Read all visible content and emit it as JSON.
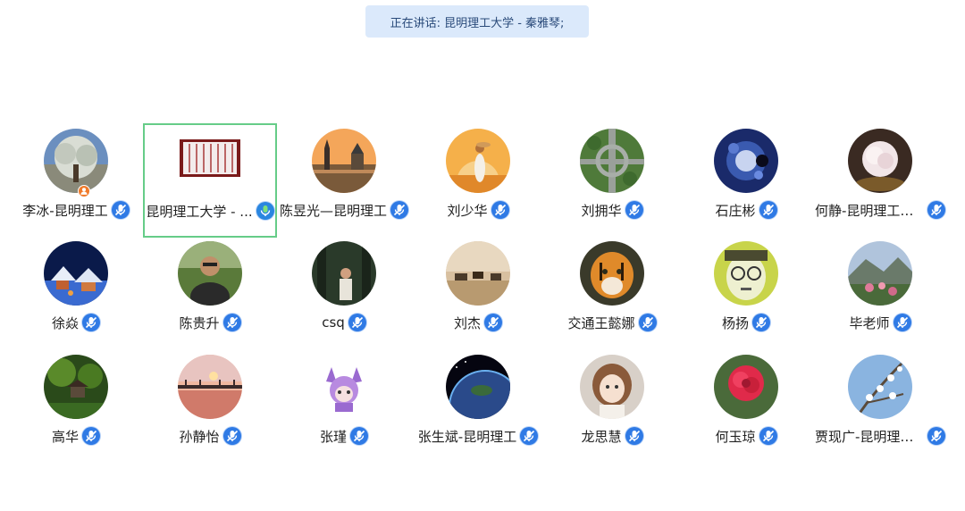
{
  "banner": {
    "text": "正在讲话: 昆明理工大学 - 秦雅琴;"
  },
  "participants": [
    {
      "name": "李冰-昆明理工",
      "host": true,
      "mic": "muted",
      "avatar": "tree"
    },
    {
      "name": "昆明理工大学 - ...",
      "host": false,
      "mic": "speaking",
      "avatar": "scroll",
      "active": true
    },
    {
      "name": "陈昱光—昆明理工",
      "host": false,
      "mic": "muted",
      "avatar": "castle"
    },
    {
      "name": "刘少华",
      "host": false,
      "mic": "muted",
      "avatar": "sunset-girl"
    },
    {
      "name": "刘拥华",
      "host": false,
      "mic": "muted",
      "avatar": "highway"
    },
    {
      "name": "石庄彬",
      "host": false,
      "mic": "muted",
      "avatar": "fractal"
    },
    {
      "name": "何静-昆明理工大...",
      "host": false,
      "mic": "muted",
      "avatar": "peony"
    },
    {
      "name": "徐焱",
      "host": false,
      "mic": "muted",
      "avatar": "snow-village"
    },
    {
      "name": "陈贵升",
      "host": false,
      "mic": "muted",
      "avatar": "man-portrait"
    },
    {
      "name": "csq",
      "host": false,
      "mic": "muted",
      "avatar": "woman-forest"
    },
    {
      "name": "刘杰",
      "host": false,
      "mic": "muted",
      "avatar": "horses"
    },
    {
      "name": "交通王懿娜",
      "host": false,
      "mic": "muted",
      "avatar": "tiger"
    },
    {
      "name": "杨扬",
      "host": false,
      "mic": "muted",
      "avatar": "cartoon-face"
    },
    {
      "name": "毕老师",
      "host": false,
      "mic": "muted",
      "avatar": "mountain-flowers"
    },
    {
      "name": "高华",
      "host": false,
      "mic": "muted",
      "avatar": "garden"
    },
    {
      "name": "孙静怡",
      "host": false,
      "mic": "muted",
      "avatar": "pier-sunset"
    },
    {
      "name": "张瑾",
      "host": false,
      "mic": "muted",
      "avatar": "anime-cat"
    },
    {
      "name": "张生斌-昆明理工",
      "host": false,
      "mic": "muted",
      "avatar": "earth"
    },
    {
      "name": "龙思慧",
      "host": false,
      "mic": "muted",
      "avatar": "cartoon-girl"
    },
    {
      "name": "何玉琼",
      "host": false,
      "mic": "muted",
      "avatar": "red-flower"
    },
    {
      "name": "贾现广-昆明理工...",
      "host": false,
      "mic": "muted",
      "avatar": "blossom-sky"
    }
  ]
}
